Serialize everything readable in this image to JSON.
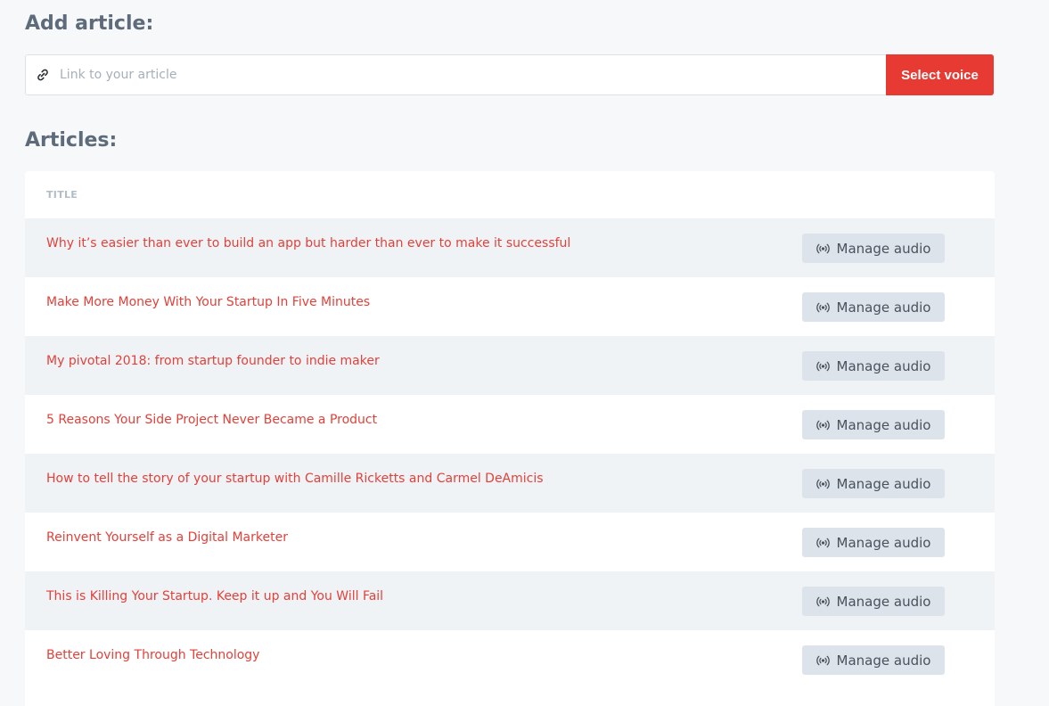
{
  "add_section": {
    "title": "Add article:",
    "input_placeholder": "Link to your article",
    "input_value": "",
    "select_voice_label": "Select voice"
  },
  "articles_section": {
    "title": "Articles:",
    "column_header": "TITLE",
    "manage_label": "Manage audio",
    "rows": [
      "Why it’s easier than ever to build an app but harder than ever to make it successful",
      "Make More Money With Your Startup In Five Minutes",
      "My pivotal 2018: from startup founder to indie maker",
      "5 Reasons Your Side Project Never Became a Product",
      "How to tell the story of your startup with Camille Ricketts and Carmel DeAmicis",
      "Reinvent Yourself as a Digital Marketer",
      "This is Killing Your Startup. Keep it up and You Will Fail",
      "Better Loving Through Technology"
    ]
  },
  "icons": {
    "input_icon": "link-icon",
    "button_icon": "broadcast-icon"
  },
  "colors": {
    "accent": "#e63a33",
    "title_link": "#e3403a",
    "button_bg": "#dde3ea",
    "heading": "#5e6b7a"
  }
}
